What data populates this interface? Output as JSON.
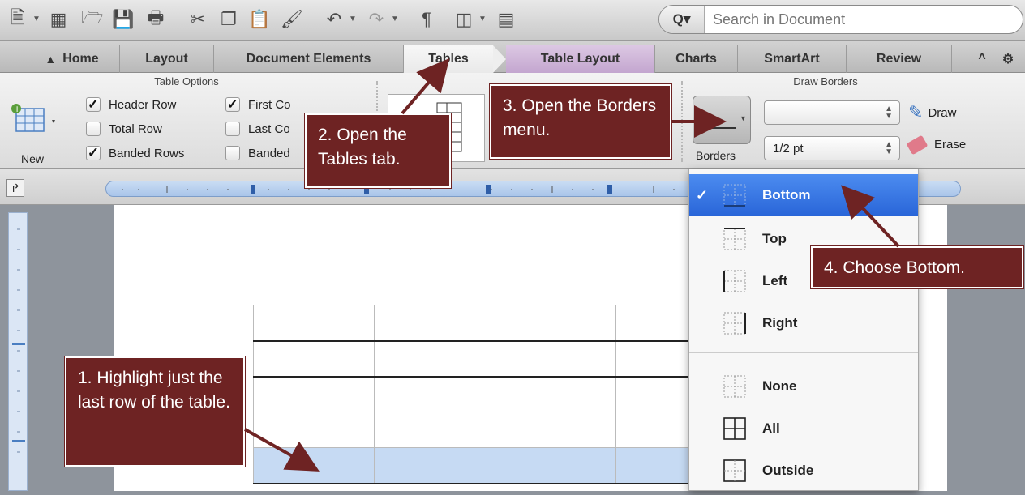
{
  "search": {
    "placeholder": "Search in Document"
  },
  "tabs": [
    {
      "label": "Home"
    },
    {
      "label": "Layout"
    },
    {
      "label": "Document Elements"
    },
    {
      "label": "Tables"
    },
    {
      "label": "Table Layout"
    },
    {
      "label": "Charts"
    },
    {
      "label": "SmartArt"
    },
    {
      "label": "Review"
    }
  ],
  "ribbon": {
    "table_options_title": "Table Options",
    "new_label": "New",
    "checkboxes": [
      {
        "label": "Header Row",
        "checked": true
      },
      {
        "label": "Total Row",
        "checked": false
      },
      {
        "label": "Banded Rows",
        "checked": true
      },
      {
        "label": "First Co",
        "checked": true
      },
      {
        "label": "Last Co",
        "checked": false
      },
      {
        "label": "Banded",
        "checked": false
      }
    ],
    "draw_borders_title": "Draw Borders",
    "borders_label": "Borders",
    "line_weight": "1/2 pt",
    "draw_label": "Draw",
    "erase_label": "Erase"
  },
  "menu": {
    "items": [
      {
        "label": "Bottom",
        "selected": true,
        "icon": "border-bottom-icon"
      },
      {
        "label": "Top",
        "selected": false,
        "icon": "border-top-icon"
      },
      {
        "label": "Left",
        "selected": false,
        "icon": "border-left-icon"
      },
      {
        "label": "Right",
        "selected": false,
        "icon": "border-right-icon"
      },
      {
        "label": "None",
        "selected": false,
        "icon": "border-none-icon"
      },
      {
        "label": "All",
        "selected": false,
        "icon": "border-all-icon"
      },
      {
        "label": "Outside",
        "selected": false,
        "icon": "border-outside-icon"
      }
    ]
  },
  "callouts": {
    "step1": "1. Highlight just the last row of the table.",
    "step2": "2. Open the Tables tab.",
    "step3": "3. Open the Borders menu.",
    "step4": "4. Choose Bottom."
  },
  "colors": {
    "callout": "#6e2323",
    "highlight": "#2965d8",
    "selection": "#c6daf3",
    "active_tab": "#c3a6cf"
  }
}
